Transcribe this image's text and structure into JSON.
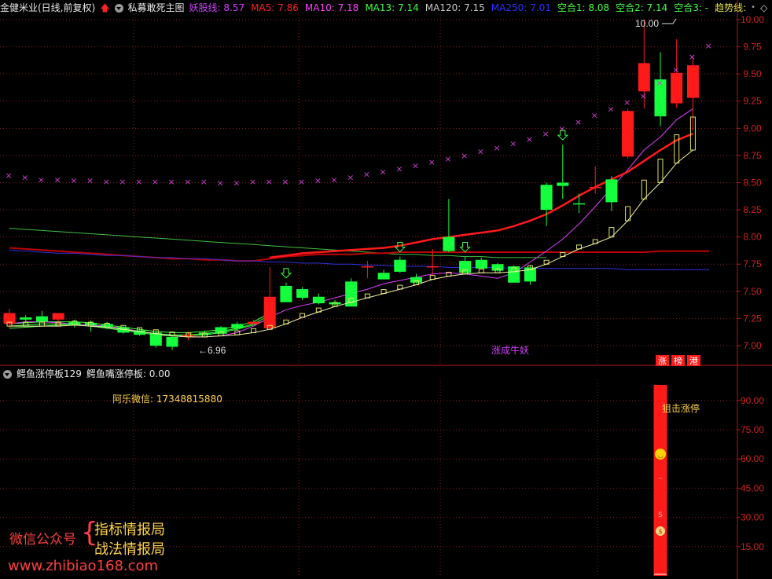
{
  "main_header": {
    "stock": "金健米业(日线,前复权)",
    "formula": "私募敢死主图",
    "indicators": [
      {
        "text": "妖股线: 8.57",
        "color": "#d040ff"
      },
      {
        "text": "MA5: 7.86",
        "color": "#ff2020"
      },
      {
        "text": "MA10: 7.18",
        "color": "#ff40ff"
      },
      {
        "text": "MA13: 7.14",
        "color": "#40ff40"
      },
      {
        "text": "MA120: 7.15",
        "color": "#c8c8c8"
      },
      {
        "text": "MA250: 7.01",
        "color": "#3030ff"
      },
      {
        "text": "空合1: 8.08",
        "color": "#40ff40"
      },
      {
        "text": "空合2: 7.14",
        "color": "#40ff40"
      },
      {
        "text": "空合3: -",
        "color": "#40ff40"
      },
      {
        "text": "趋势线:",
        "color": "#e0e040"
      }
    ]
  },
  "sub_header": {
    "formula": "鳄鱼涨停板129",
    "value_label": "鳄鱼嘴涨停板: 0.00"
  },
  "price_axis": [
    "10.00",
    "9.75",
    "9.50",
    "9.25",
    "9.00",
    "8.75",
    "8.50",
    "8.25",
    "8.00",
    "7.75",
    "7.50",
    "7.25",
    "7.00"
  ],
  "sub_axis": [
    "90.00",
    "75.00",
    "60.00",
    "45.00",
    "30.00",
    "15.00"
  ],
  "annotations": {
    "high_label": "10.00",
    "low_label": "6.96",
    "signal_text": "涨成牛妖",
    "tags": [
      "涨",
      "榜",
      "港"
    ],
    "contact": "阿乐微信: 17348815880",
    "snipe_text": "狙击涨停"
  },
  "watermark": {
    "left_text": "微信公众号",
    "line1": "指标情报局",
    "line2": "战法情报局",
    "url": "www.zhibiao168.com"
  },
  "colors": {
    "up": "#ff1a1a",
    "down": "#14ff3c",
    "grid": "#8a1c1c",
    "axis": "#b01a1a",
    "sar": "#d040d0",
    "trend": "#e0e060"
  },
  "chart_data": {
    "type": "candlestick",
    "candles": [
      {
        "o": 7.2,
        "h": 7.34,
        "l": 7.16,
        "c": 7.3
      },
      {
        "o": 7.26,
        "h": 7.28,
        "l": 7.22,
        "c": 7.24
      },
      {
        "o": 7.27,
        "h": 7.32,
        "l": 7.22,
        "c": 7.22
      },
      {
        "o": 7.24,
        "h": 7.3,
        "l": 7.18,
        "c": 7.3
      },
      {
        "o": 7.22,
        "h": 7.24,
        "l": 7.17,
        "c": 7.19
      },
      {
        "o": 7.21,
        "h": 7.23,
        "l": 7.13,
        "c": 7.19
      },
      {
        "o": 7.2,
        "h": 7.22,
        "l": 7.15,
        "c": 7.17
      },
      {
        "o": 7.17,
        "h": 7.18,
        "l": 7.11,
        "c": 7.12
      },
      {
        "o": 7.14,
        "h": 7.16,
        "l": 7.09,
        "c": 7.1
      },
      {
        "o": 7.12,
        "h": 7.14,
        "l": 6.98,
        "c": 7.0
      },
      {
        "o": 7.08,
        "h": 7.1,
        "l": 6.96,
        "c": 6.99
      },
      {
        "o": 7.08,
        "h": 7.13,
        "l": 7.05,
        "c": 7.1
      },
      {
        "o": 7.12,
        "h": 7.14,
        "l": 7.09,
        "c": 7.1
      },
      {
        "o": 7.17,
        "h": 7.18,
        "l": 7.1,
        "c": 7.11
      },
      {
        "o": 7.2,
        "h": 7.22,
        "l": 7.14,
        "c": 7.16
      },
      {
        "o": 7.2,
        "h": 7.24,
        "l": 7.18,
        "c": 7.22
      },
      {
        "o": 7.16,
        "h": 7.72,
        "l": 7.15,
        "c": 7.45
      },
      {
        "o": 7.55,
        "h": 7.58,
        "l": 7.4,
        "c": 7.4
      },
      {
        "o": 7.52,
        "h": 7.54,
        "l": 7.42,
        "c": 7.44
      },
      {
        "o": 7.45,
        "h": 7.48,
        "l": 7.38,
        "c": 7.39
      },
      {
        "o": 7.4,
        "h": 7.42,
        "l": 7.36,
        "c": 7.38
      },
      {
        "o": 7.59,
        "h": 7.62,
        "l": 7.36,
        "c": 7.36
      },
      {
        "o": 7.72,
        "h": 7.78,
        "l": 7.62,
        "c": 7.73
      },
      {
        "o": 7.67,
        "h": 7.7,
        "l": 7.61,
        "c": 7.61
      },
      {
        "o": 7.79,
        "h": 7.82,
        "l": 7.67,
        "c": 7.68
      },
      {
        "o": 7.63,
        "h": 7.66,
        "l": 7.57,
        "c": 7.58
      },
      {
        "o": 7.72,
        "h": 7.89,
        "l": 7.65,
        "c": 7.73
      },
      {
        "o": 8.0,
        "h": 8.35,
        "l": 7.86,
        "c": 7.87
      },
      {
        "o": 7.78,
        "h": 7.82,
        "l": 7.67,
        "c": 7.67
      },
      {
        "o": 7.79,
        "h": 7.81,
        "l": 7.72,
        "c": 7.71
      },
      {
        "o": 7.75,
        "h": 7.76,
        "l": 7.68,
        "c": 7.69
      },
      {
        "o": 7.73,
        "h": 7.74,
        "l": 7.58,
        "c": 7.58
      },
      {
        "o": 7.72,
        "h": 7.74,
        "l": 7.56,
        "c": 7.59
      },
      {
        "o": 8.48,
        "h": 8.5,
        "l": 8.1,
        "c": 8.25
      },
      {
        "o": 8.5,
        "h": 8.85,
        "l": 8.35,
        "c": 8.47
      },
      {
        "o": 8.31,
        "h": 8.4,
        "l": 8.22,
        "c": 8.3
      },
      {
        "o": 8.45,
        "h": 8.65,
        "l": 8.4,
        "c": 8.46
      },
      {
        "o": 8.53,
        "h": 8.56,
        "l": 8.24,
        "c": 8.32
      },
      {
        "o": 8.74,
        "h": 9.18,
        "l": 8.72,
        "c": 9.16
      },
      {
        "o": 9.34,
        "h": 10.0,
        "l": 9.18,
        "c": 9.6
      },
      {
        "o": 9.45,
        "h": 9.7,
        "l": 9.02,
        "c": 9.11
      },
      {
        "o": 9.23,
        "h": 9.82,
        "l": 9.19,
        "c": 9.51
      },
      {
        "o": 9.28,
        "h": 9.67,
        "l": 8.98,
        "c": 9.58
      }
    ],
    "sar": [
      8.57,
      8.55,
      8.53,
      8.53,
      8.52,
      8.52,
      8.51,
      8.51,
      8.51,
      8.51,
      8.51,
      8.51,
      8.51,
      8.5,
      8.5,
      8.51,
      8.51,
      8.51,
      8.51,
      8.52,
      8.53,
      8.55,
      8.58,
      8.6,
      8.63,
      8.66,
      8.69,
      8.72,
      8.75,
      8.79,
      8.82,
      8.86,
      8.9,
      8.95,
      9.0,
      9.06,
      9.12,
      9.18,
      9.24,
      9.3,
      9.42,
      9.54,
      9.66,
      9.76
    ],
    "ma5": [
      7.87,
      7.87,
      7.86,
      7.86,
      7.85,
      7.84,
      7.84,
      7.83,
      7.82,
      7.81,
      7.81,
      7.81,
      7.8,
      7.8,
      7.8,
      7.8,
      7.81,
      7.83,
      7.85,
      7.86,
      7.87,
      7.88,
      7.89,
      7.9,
      7.92,
      7.95,
      7.98,
      8.0,
      8.02,
      8.04,
      8.06,
      8.1,
      8.15,
      8.21,
      8.29,
      8.38,
      8.46,
      8.53,
      8.6,
      8.7,
      8.8,
      8.89,
      8.95
    ],
    "ma10": [
      7.2,
      7.22,
      7.22,
      7.21,
      7.2,
      7.19,
      7.18,
      7.16,
      7.13,
      7.11,
      7.09,
      7.08,
      7.08,
      7.09,
      7.12,
      7.18,
      7.26,
      7.33,
      7.37,
      7.4,
      7.44,
      7.48,
      7.52,
      7.57,
      7.6,
      7.63,
      7.66,
      7.67,
      7.66,
      7.64,
      7.62,
      7.67,
      7.77,
      7.87,
      7.98,
      8.12,
      8.28,
      8.45,
      8.62,
      8.8,
      8.92,
      9.08,
      9.18
    ],
    "ma13": [
      8.08,
      8.07,
      8.06,
      8.05,
      8.04,
      8.03,
      8.02,
      8.01,
      8.0,
      7.99,
      7.98,
      7.97,
      7.96,
      7.95,
      7.94,
      7.93,
      7.92,
      7.91,
      7.9,
      7.89,
      7.88,
      7.87,
      7.86,
      7.85,
      7.84,
      7.84,
      7.83,
      7.83,
      7.82,
      7.82,
      7.81,
      7.81,
      7.81,
      7.81
    ],
    "ma250": [
      7.88,
      7.87,
      7.86,
      7.85,
      7.85,
      7.84,
      7.83,
      7.83,
      7.82,
      7.81,
      7.81,
      7.8,
      7.8,
      7.79,
      7.78,
      7.78,
      7.77,
      7.77,
      7.76,
      7.76,
      7.75,
      7.75,
      7.74,
      7.74,
      7.73,
      7.73,
      7.73,
      7.72,
      7.72,
      7.72,
      7.72,
      7.71,
      7.71,
      7.71,
      7.71,
      7.71,
      7.71,
      7.71,
      7.7,
      7.7,
      7.7,
      7.7,
      7.7,
      7.7
    ],
    "ma120": [
      7.9,
      7.89,
      7.88,
      7.87,
      7.86,
      7.85,
      7.84,
      7.83,
      7.82,
      7.81,
      7.8,
      7.8,
      7.79,
      7.79,
      7.78,
      7.78,
      7.8,
      7.82,
      7.83,
      7.84,
      7.84,
      7.84,
      7.85,
      7.85,
      7.86,
      7.86,
      7.86,
      7.86,
      7.86,
      7.86,
      7.86,
      7.86,
      7.86,
      7.86,
      7.86,
      7.86,
      7.86,
      7.86,
      7.86,
      7.86,
      7.87,
      7.87,
      7.87,
      7.87
    ],
    "trend_boxes": [
      7.18,
      7.18,
      7.18,
      7.18,
      7.19,
      7.18,
      7.17,
      7.15,
      7.13,
      7.11,
      7.09,
      7.08,
      7.08,
      7.09,
      7.1,
      7.12,
      7.15,
      7.2,
      7.26,
      7.31,
      7.36,
      7.4,
      7.44,
      7.48,
      7.52,
      7.56,
      7.61,
      7.64,
      7.66,
      7.67,
      7.67,
      7.68,
      7.7,
      7.75,
      7.82,
      7.89,
      7.94,
      8.0,
      8.15,
      8.35,
      8.5,
      8.68,
      8.8
    ],
    "cluster_lines": [
      [
        7.18,
        7.19,
        7.2,
        7.2,
        7.2,
        7.19,
        7.17,
        7.15,
        7.13,
        7.11,
        7.1,
        7.1,
        7.11,
        7.13,
        7.16,
        7.2,
        7.28
      ],
      [
        7.16,
        7.17,
        7.18,
        7.19,
        7.19,
        7.18,
        7.16,
        7.14,
        7.12,
        7.1,
        7.09,
        7.09,
        7.1,
        7.12,
        7.15,
        7.19,
        7.25
      ],
      [
        7.2,
        7.21,
        7.22,
        7.22,
        7.22,
        7.21,
        7.19,
        7.17,
        7.15,
        7.13,
        7.12,
        7.12,
        7.13,
        7.15,
        7.18,
        7.22,
        7.3
      ]
    ],
    "arrows_down": [
      17,
      24,
      28,
      34
    ],
    "ylim": [
      6.9,
      10.1
    ],
    "sub_bar": {
      "index": 40,
      "value": 98
    }
  }
}
